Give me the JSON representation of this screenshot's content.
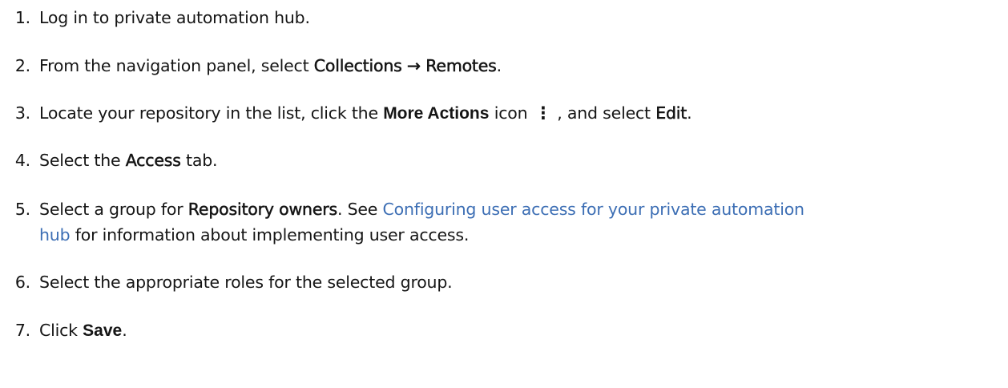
{
  "steps": [
    {
      "number": "1.",
      "text": "Log in to private automation hub."
    },
    {
      "number": "2.",
      "pre": "From the navigation panel, select ",
      "menu_a": "Collections",
      "arrow": "→",
      "menu_b": "Remotes",
      "post": "."
    },
    {
      "number": "3.",
      "pre": "Locate your repository in the list, click the ",
      "strong": "More Actions",
      "mid": " icon",
      "icon": "⋮",
      "mid2": ", and select ",
      "menu": "Edit",
      "post": "."
    },
    {
      "number": "4.",
      "pre": "Select the ",
      "menu": "Access",
      "post": " tab."
    },
    {
      "number": "5.",
      "pre": "Select a group for ",
      "menu": "Repository owners",
      "mid": ". See ",
      "link_line1": "Configuring user access for your private automation",
      "link_line2": "hub",
      "post": " for information about implementing user access."
    },
    {
      "number": "6.",
      "text": "Select the appropriate roles for the selected group."
    },
    {
      "number": "7.",
      "pre": "Click ",
      "strong": "Save",
      "post": "."
    }
  ],
  "icons": {
    "more_actions": "kebab-icon"
  },
  "colors": {
    "text": "#151515",
    "link": "#3c6eb4"
  }
}
